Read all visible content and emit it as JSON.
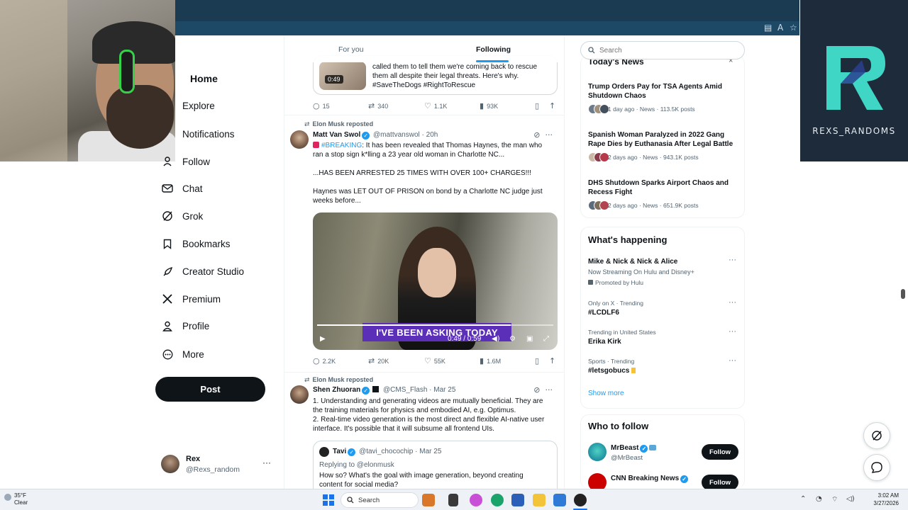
{
  "overlay": {
    "channel_name": "REXS_RANDOMS"
  },
  "nav": {
    "items": [
      {
        "label": "Home",
        "icon": "home-icon"
      },
      {
        "label": "Explore",
        "icon": "search-icon"
      },
      {
        "label": "Notifications",
        "icon": "bell-icon"
      },
      {
        "label": "Follow",
        "icon": "person-add-icon"
      },
      {
        "label": "Chat",
        "icon": "mail-icon"
      },
      {
        "label": "Grok",
        "icon": "grok-icon"
      },
      {
        "label": "Bookmarks",
        "icon": "bookmark-icon"
      },
      {
        "label": "Creator Studio",
        "icon": "rocket-icon"
      },
      {
        "label": "Premium",
        "icon": "x-logo-icon"
      },
      {
        "label": "Profile",
        "icon": "person-icon"
      },
      {
        "label": "More",
        "icon": "more-circle-icon"
      }
    ],
    "post_label": "Post",
    "account": {
      "name": "Rex",
      "handle": "@Rexs_random",
      "more": "···"
    }
  },
  "timeline": {
    "tabs": [
      "For you",
      "Following"
    ],
    "active_tab": "Following",
    "quote1": {
      "duration": "0:49",
      "lines": [
        "called them to tell them we're coming back to rescue",
        "them all despite their legal threats. Here's why.",
        "#SaveTheDogs #RightToRescue"
      ]
    },
    "post1_actions": {
      "replies": "15",
      "reposts": "340",
      "likes": "1.1K",
      "views": "93K"
    },
    "post2": {
      "reposted_by": "Elon Musk reposted",
      "name": "Matt Van Swol",
      "handle_time": "@mattvanswol · 20h",
      "hashtag": "#BREAKING",
      "line1_rest": ": It has been revealed that Thomas Haynes, the man who",
      "line2": "ran a stop sign k*lling a 23 year old woman in Charlotte NC...",
      "line3": "...HAS BEEN ARRESTED 25 TIMES WITH OVER 100+ CHARGES!!!",
      "line4": "Haynes was LET OUT OF PRISON on bond by a Charlotte NC judge just",
      "line5": "weeks before...",
      "video_caption": "I'VE BEEN ASKING TODAY",
      "video_time": "0:49 / 0:59",
      "actions": {
        "replies": "2.2K",
        "reposts": "20K",
        "likes": "55K",
        "views": "1.6M"
      }
    },
    "post3": {
      "reposted_by": "Elon Musk reposted",
      "name": "Shen Zhuoran",
      "handle_time": "@CMS_Flash · Mar 25",
      "line1": "1. Understanding and generating videos are mutually beneficial. They are",
      "line2": "the training materials for physics and embodied AI, e.g. Optimus.",
      "line3": "2. Real-time video generation is the most direct and flexible AI-native user",
      "line4": "interface. It's possible that it will subsume all frontend UIs.",
      "quote": {
        "name": "Tavi",
        "handle_time": "@tavi_chocochip · Mar 25",
        "replying": "Replying to @elonmusk",
        "text1": "How so? What's the goal with image generation, beyond creating",
        "text2": "content for social media?"
      }
    }
  },
  "sidebar": {
    "search_placeholder": "Search",
    "news": {
      "title": "Today's News",
      "items": [
        {
          "title": "Trump Orders Pay for TSA Agents Amid Shutdown Chaos",
          "meta": "1 day ago · News · 113.5K posts"
        },
        {
          "title": "Spanish Woman Paralyzed in 2022 Gang Rape Dies by Euthanasia After Legal Battle",
          "meta": "2 days ago · News · 943.1K posts"
        },
        {
          "title": "DHS Shutdown Sparks Airport Chaos and Recess Fight",
          "meta": "2 days ago · News · 651.9K posts"
        }
      ]
    },
    "happening": {
      "title": "What's happening",
      "promo": {
        "name": "Mike & Nick & Nick & Alice",
        "sub": "Now Streaming On Hulu and Disney+",
        "promoted": "Promoted by Hulu"
      },
      "trends": [
        {
          "category": "Only on X · Trending",
          "name": "#LCDLF6"
        },
        {
          "category": "Trending in United States",
          "name": "Erika Kirk"
        },
        {
          "category": "Sports · Trending",
          "name": "#letsgobucs"
        }
      ],
      "show_more": "Show more"
    },
    "who_to_follow": {
      "title": "Who to follow",
      "accounts": [
        {
          "name": "MrBeast",
          "handle": "@MrBeast",
          "button": "Follow"
        },
        {
          "name": "CNN Breaking News",
          "handle": "",
          "button": "Follow"
        }
      ]
    }
  },
  "taskbar": {
    "temperature": "35°F",
    "condition": "Clear",
    "search": "Search",
    "time": "3:02 AM",
    "date": "3/27/2026"
  },
  "colors": {
    "accent": "#1d9bf0",
    "text": "#0f1419",
    "muted": "#536471",
    "overlay_teal": "#3fd6c6"
  }
}
